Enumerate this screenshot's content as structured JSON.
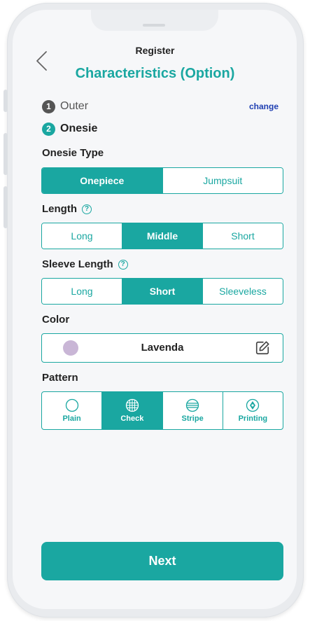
{
  "header": {
    "subtitle": "Register",
    "title": "Characteristics (Option)"
  },
  "steps": [
    {
      "number": "1",
      "label": "Outer"
    },
    {
      "number": "2",
      "label": "Onesie"
    }
  ],
  "change_label": "change",
  "onesie_type": {
    "label": "Onesie Type",
    "options": [
      "Onepiece",
      "Jumpsuit"
    ],
    "selected": "Onepiece"
  },
  "length": {
    "label": "Length",
    "help_glyph": "?",
    "options": [
      "Long",
      "Middle",
      "Short"
    ],
    "selected": "Middle"
  },
  "sleeve_length": {
    "label": "Sleeve Length",
    "help_glyph": "?",
    "options": [
      "Long",
      "Short",
      "Sleeveless"
    ],
    "selected": "Short"
  },
  "color": {
    "label": "Color",
    "value": "Lavenda",
    "swatch": "#c9b6d6"
  },
  "pattern": {
    "label": "Pattern",
    "options": [
      {
        "label": "Plain",
        "icon": "circle-icon"
      },
      {
        "label": "Check",
        "icon": "grid-globe-icon"
      },
      {
        "label": "Stripe",
        "icon": "stripe-circle-icon"
      },
      {
        "label": "Printing",
        "icon": "printing-icon"
      }
    ],
    "selected": "Check"
  },
  "next_label": "Next",
  "colors": {
    "accent": "#1aa7a1",
    "change_link": "#1f3fb2"
  }
}
